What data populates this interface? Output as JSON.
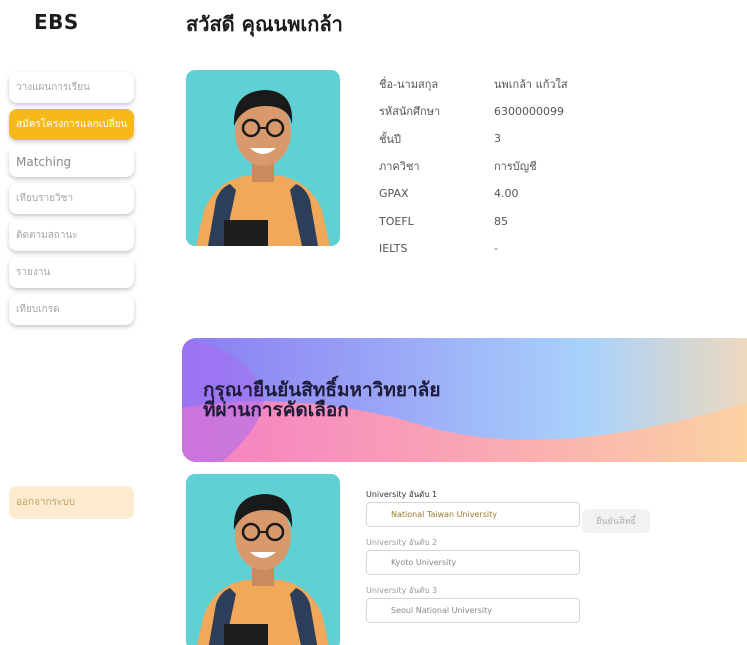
{
  "app": {
    "logo": "EBS"
  },
  "header": {
    "greeting": "สวัสดี คุณนพเกล้า"
  },
  "sidebar": {
    "items": [
      {
        "label": "วางแผนการเรียน",
        "active": false
      },
      {
        "label": "สมัครโครงการแลกเปลี่ยน",
        "active": true
      },
      {
        "label": "Matching",
        "active": false
      },
      {
        "label": "เทียบรายวิชา",
        "active": false
      },
      {
        "label": "ติดตามสถานะ",
        "active": false
      },
      {
        "label": "รายงาน",
        "active": false
      },
      {
        "label": "เทียบเกรด",
        "active": false
      }
    ],
    "logout_label": "ออกจากระบบ"
  },
  "profile": {
    "rows": [
      {
        "label": "ชื่อ-นามสกุล",
        "value": "นพเกล้า แก้วใส"
      },
      {
        "label": "รหัสนักศึกษา",
        "value": "6300000099"
      },
      {
        "label": "ชั้นปี",
        "value": "3"
      },
      {
        "label": "ภาควิชา",
        "value": "การบัญชี"
      },
      {
        "label": "GPAX",
        "value": "4.00"
      },
      {
        "label": "TOEFL",
        "value": "85"
      },
      {
        "label": "IELTS",
        "value": "-"
      }
    ]
  },
  "banner": {
    "line1": "กรุณายืนยันสิทธิ์มหาวิทยาลัย",
    "line2": "ที่ผ่านการคัดเลือก"
  },
  "universities": [
    {
      "label": "University อันดับ 1",
      "value": "National Taiwan University"
    },
    {
      "label": "University อันดับ 2",
      "value": "Kyoto University"
    },
    {
      "label": "University อันดับ 3",
      "value": "Seoul National University"
    }
  ],
  "confirm_label": "ยืนยันสิทธิ์",
  "colors": {
    "accent": "#f6b81a",
    "photo_bg": "#5fd0d4",
    "shirt": "#f0a95a",
    "logout_bg": "#fdeacf"
  }
}
